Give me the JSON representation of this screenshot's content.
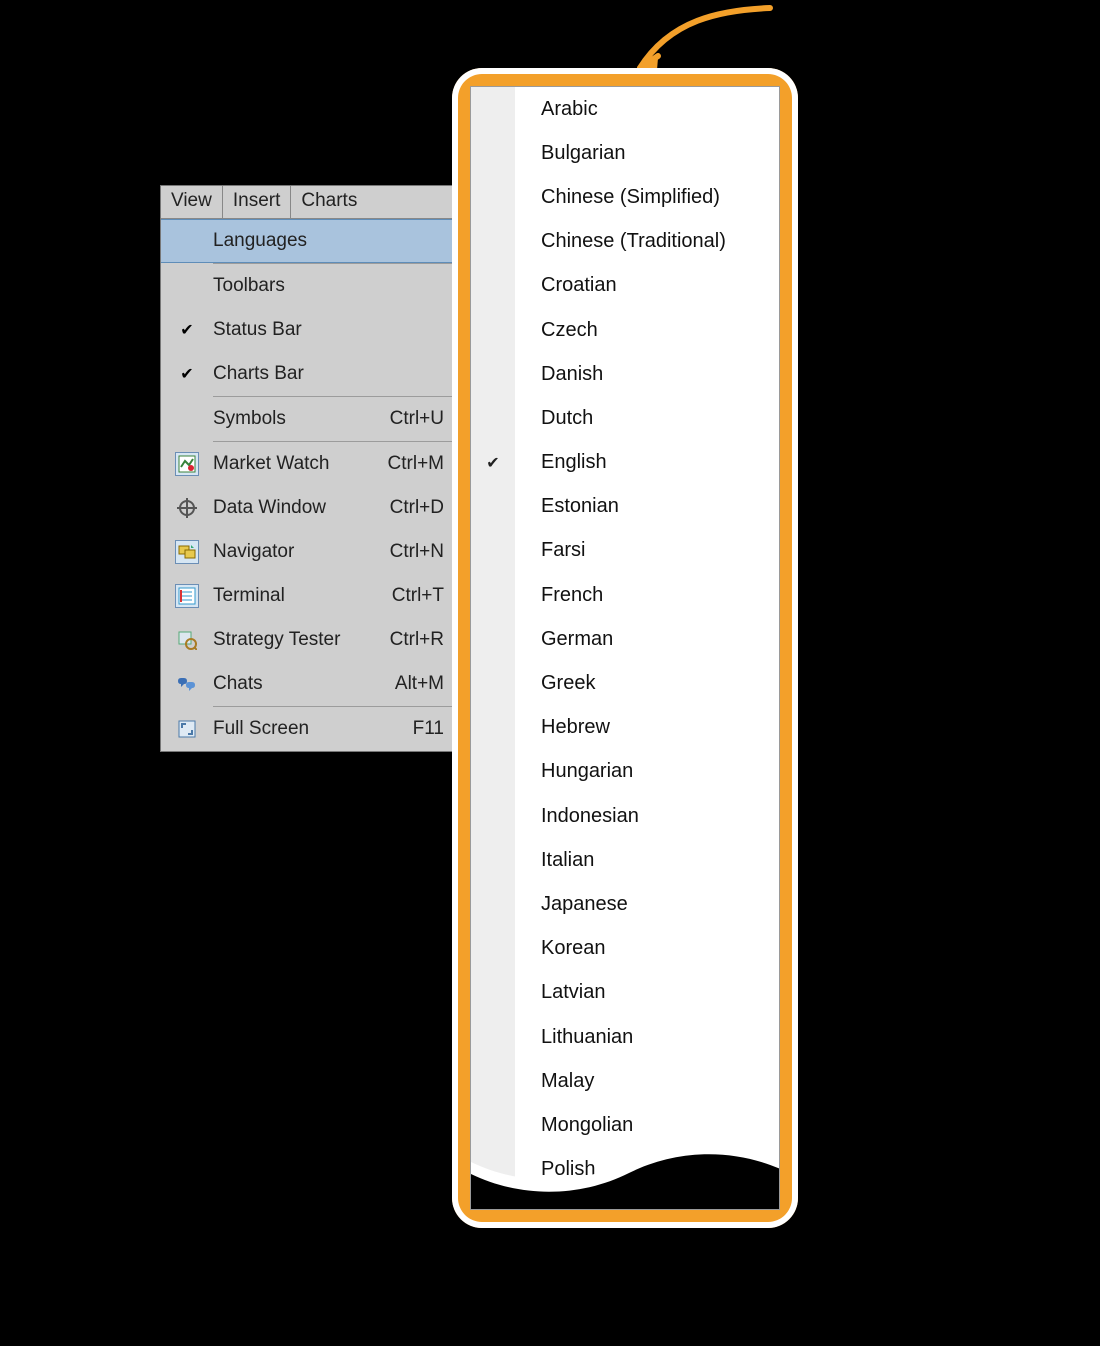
{
  "menubar": {
    "view": "View",
    "insert": "Insert",
    "charts": "Charts"
  },
  "dropdown": {
    "languages": "Languages",
    "toolbars": "Toolbars",
    "status_bar": "Status Bar",
    "charts_bar": "Charts Bar",
    "symbols": {
      "label": "Symbols",
      "shortcut": "Ctrl+U"
    },
    "market": {
      "label": "Market Watch",
      "shortcut": "Ctrl+M"
    },
    "datawin": {
      "label": "Data Window",
      "shortcut": "Ctrl+D"
    },
    "navigator": {
      "label": "Navigator",
      "shortcut": "Ctrl+N"
    },
    "terminal": {
      "label": "Terminal",
      "shortcut": "Ctrl+T"
    },
    "tester": {
      "label": "Strategy Tester",
      "shortcut": "Ctrl+R"
    },
    "chats": {
      "label": "Chats",
      "shortcut": "Alt+M"
    },
    "fullscreen": {
      "label": "Full Screen",
      "shortcut": "F11"
    }
  },
  "languages": {
    "checked_index": 8,
    "items": [
      "Arabic",
      "Bulgarian",
      "Chinese (Simplified)",
      "Chinese (Traditional)",
      "Croatian",
      "Czech",
      "Danish",
      "Dutch",
      "English",
      "Estonian",
      "Farsi",
      "French",
      "German",
      "Greek",
      "Hebrew",
      "Hungarian",
      "Indonesian",
      "Italian",
      "Japanese",
      "Korean",
      "Latvian",
      "Lithuanian",
      "Malay",
      "Mongolian",
      "Polish"
    ]
  },
  "colors": {
    "accent_orange": "#f3a02a",
    "menu_highlight": "#a9c3dd"
  }
}
